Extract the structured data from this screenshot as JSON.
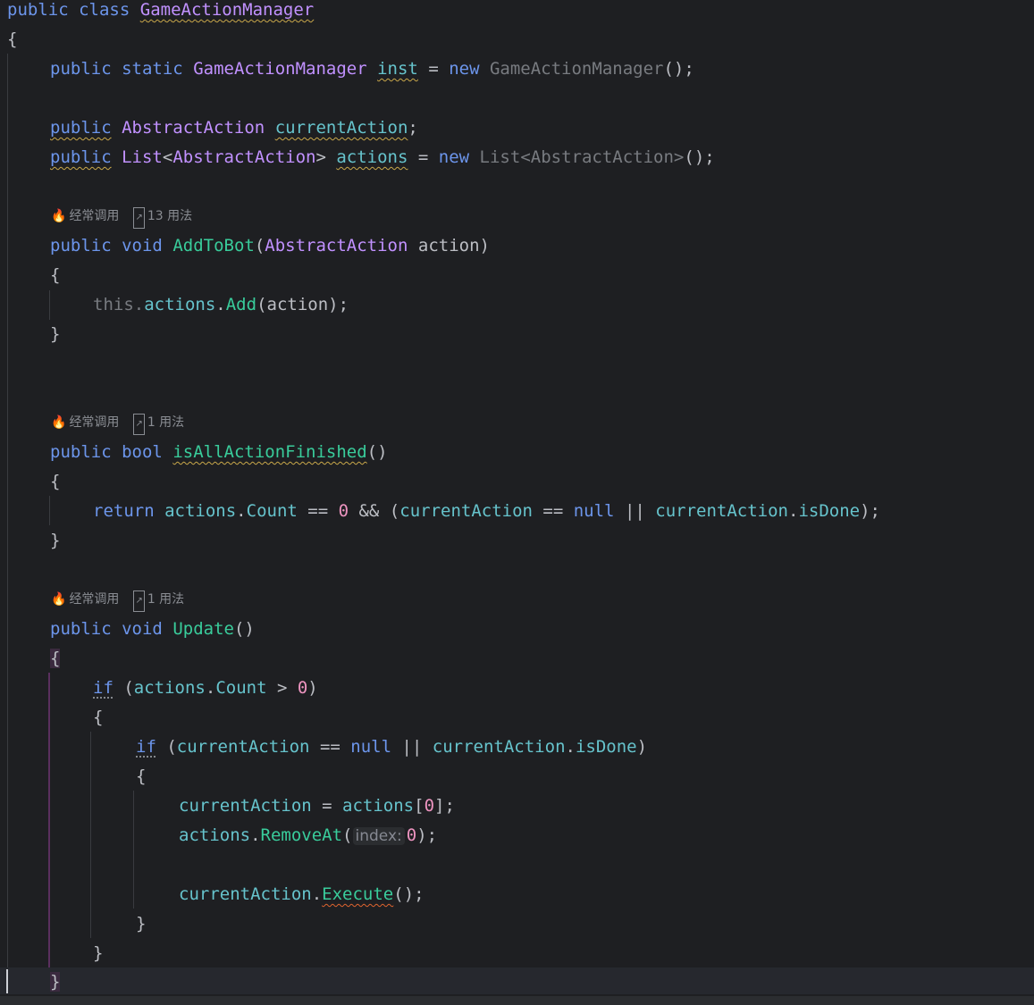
{
  "editor": {
    "hints": {
      "frequent_label": "经常调用",
      "usages_13": "13 用法",
      "usages_1": "1 用法"
    },
    "param_hint": "index:",
    "tokens": {
      "public": "public",
      "class": "class",
      "static": "static",
      "new": "new",
      "void": "void",
      "bool": "bool",
      "return": "return",
      "this": "this.",
      "null": "null",
      "if": "if",
      "GameActionManager": "GameActionManager",
      "inst": "inst",
      "AbstractAction": "AbstractAction",
      "List": "List",
      "currentAction": "currentAction",
      "actions": "actions",
      "AddToBot": "AddToBot",
      "action": "action",
      "Add": "Add",
      "isAllActionFinished": "isAllActionFinished",
      "Count": "Count",
      "isDone": "isDone",
      "Update": "Update",
      "RemoveAt": "RemoveAt",
      "Execute": "Execute",
      "zero": "0"
    }
  },
  "colors": {
    "background": "#1e1f22",
    "keyword_blue": "#6c95eb",
    "type_purple": "#c191ff",
    "method_green": "#39cc9b",
    "field_cyan": "#66c3cc",
    "number_pink": "#ed94c0"
  },
  "icons": [
    "flame-icon",
    "usages-link-icon"
  ]
}
